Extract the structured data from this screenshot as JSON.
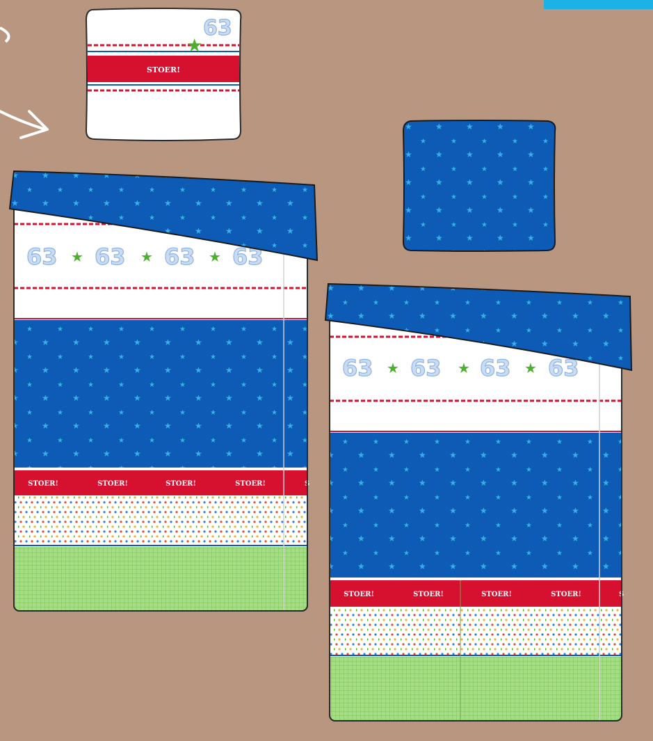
{
  "colors": {
    "background": "#b89680",
    "accent_bar": "#1bb3e6",
    "blue": "#0d5bb5",
    "light_star": "#35b3e6",
    "red": "#d6102f",
    "green_star": "#4caf2d",
    "green_check": "#9bd47a",
    "white": "#ffffff"
  },
  "pillow_top": {
    "label": "STOER!",
    "number": "63"
  },
  "duvet_left": {
    "numbers": [
      "63",
      "63",
      "63",
      "63"
    ],
    "band_labels": [
      "STOER!",
      "STOER!",
      "STOER!",
      "STOER!",
      "S"
    ]
  },
  "duvet_right": {
    "numbers": [
      "63",
      "63",
      "63",
      "63"
    ],
    "band_labels": [
      "STOER!",
      "STOER!",
      "STOER!",
      "STOER!",
      "S"
    ]
  },
  "icons": [
    "arrow-icon",
    "star-icon"
  ]
}
